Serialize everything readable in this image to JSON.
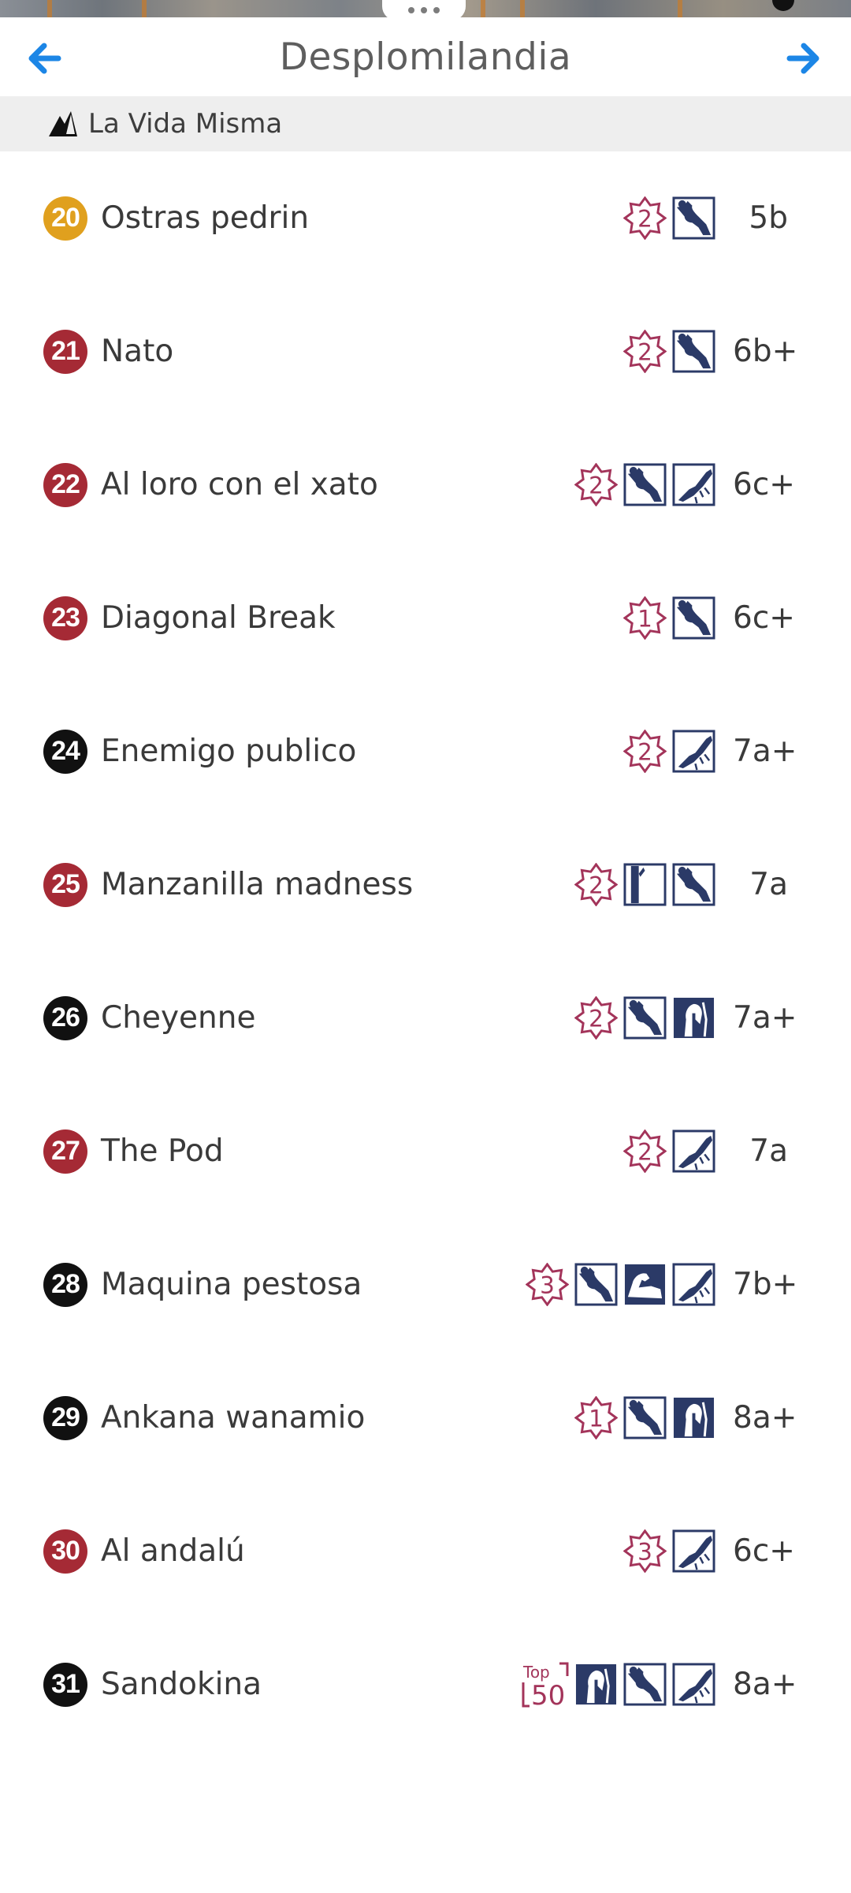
{
  "header": {
    "title": "Desplomilandia"
  },
  "sector": {
    "name": "La Vida Misma"
  },
  "colors": {
    "yellow": "#e0a01e",
    "red": "#a52a35",
    "black": "#111111",
    "accent_blue": "#1c86e6",
    "icon_navy": "#2b3a67",
    "icon_magenta": "#a3345a"
  },
  "routes": [
    {
      "number": "20",
      "name": "Ostras pedrin",
      "grade": "5b",
      "color": "yellow",
      "icons": [
        "rating-2",
        "overhang"
      ]
    },
    {
      "number": "21",
      "name": "Nato",
      "grade": "6b+",
      "color": "red",
      "icons": [
        "rating-2",
        "overhang"
      ]
    },
    {
      "number": "22",
      "name": "Al loro con el xato",
      "grade": "6c+",
      "color": "red",
      "icons": [
        "rating-2",
        "overhang",
        "roof"
      ]
    },
    {
      "number": "23",
      "name": "Diagonal Break",
      "grade": "6c+",
      "color": "red",
      "icons": [
        "rating-1",
        "overhang"
      ]
    },
    {
      "number": "24",
      "name": "Enemigo publico",
      "grade": "7a+",
      "color": "black",
      "icons": [
        "rating-2",
        "roof"
      ]
    },
    {
      "number": "25",
      "name": "Manzanilla madness",
      "grade": "7a",
      "color": "red",
      "icons": [
        "rating-2",
        "vertical",
        "overhang"
      ]
    },
    {
      "number": "26",
      "name": "Cheyenne",
      "grade": "7a+",
      "color": "black",
      "icons": [
        "rating-2",
        "overhang",
        "crimp"
      ]
    },
    {
      "number": "27",
      "name": "The Pod",
      "grade": "7a",
      "color": "red",
      "icons": [
        "rating-2",
        "roof"
      ]
    },
    {
      "number": "28",
      "name": "Maquina pestosa",
      "grade": "7b+",
      "color": "black",
      "icons": [
        "rating-3",
        "overhang",
        "strength",
        "roof"
      ]
    },
    {
      "number": "29",
      "name": "Ankana wanamio",
      "grade": "8a+",
      "color": "black",
      "icons": [
        "rating-1",
        "overhang",
        "crimp"
      ]
    },
    {
      "number": "30",
      "name": "Al andalú",
      "grade": "6c+",
      "color": "red",
      "icons": [
        "rating-3",
        "roof"
      ]
    },
    {
      "number": "31",
      "name": "Sandokina",
      "grade": "8a+",
      "color": "black",
      "icons": [
        "top50",
        "crimp",
        "overhang",
        "roof"
      ]
    }
  ],
  "top50_badge": {
    "line1": "Top",
    "line2": "50"
  }
}
